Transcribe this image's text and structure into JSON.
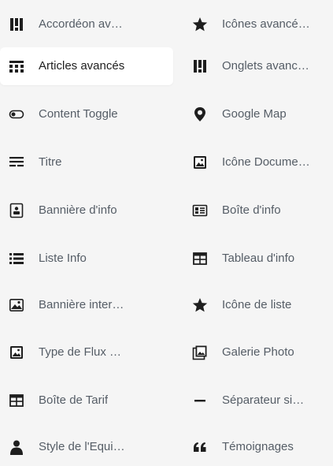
{
  "blocks": {
    "left": [
      {
        "label": "Accordéon av…",
        "icon": "accordion-icon"
      },
      {
        "label": "Articles avancés",
        "icon": "articles-grid-icon",
        "active": true
      },
      {
        "label": "Content Toggle",
        "icon": "toggle-icon"
      },
      {
        "label": "Titre",
        "icon": "heading-icon"
      },
      {
        "label": "Bannière d'info",
        "icon": "info-banner-icon"
      },
      {
        "label": "Liste Info",
        "icon": "list-icon"
      },
      {
        "label": "Bannière inter…",
        "icon": "image-icon"
      },
      {
        "label": "Type de Flux …",
        "icon": "photo-frame-icon"
      },
      {
        "label": "Boîte de Tarif",
        "icon": "table-icon"
      },
      {
        "label": "Style de l'Equi…",
        "icon": "person-icon"
      }
    ],
    "right": [
      {
        "label": "Icônes avancé…",
        "icon": "star-icon"
      },
      {
        "label": "Onglets avanc…",
        "icon": "tabs-icon"
      },
      {
        "label": "Google Map",
        "icon": "map-pin-icon"
      },
      {
        "label": "Icône Docume…",
        "icon": "document-image-icon"
      },
      {
        "label": "Boîte d'info",
        "icon": "id-card-icon"
      },
      {
        "label": "Tableau d'info",
        "icon": "table-icon"
      },
      {
        "label": "Icône de liste",
        "icon": "star-icon"
      },
      {
        "label": "Galerie Photo",
        "icon": "gallery-icon"
      },
      {
        "label": "Séparateur si…",
        "icon": "separator-icon"
      },
      {
        "label": "Témoignages",
        "icon": "quote-icon"
      }
    ]
  },
  "colors": {
    "background": "#f5f5f5",
    "active_background": "#ffffff",
    "label_text": "#555d66",
    "icon": "#1e1e1e"
  }
}
